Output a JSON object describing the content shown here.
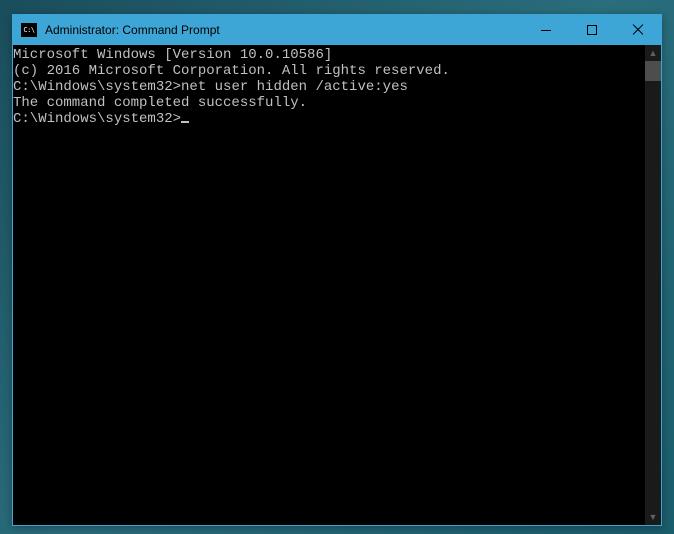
{
  "window": {
    "icon_text": "C:\\",
    "title": "Administrator: Command Prompt"
  },
  "terminal": {
    "lines": {
      "version": "Microsoft Windows [Version 10.0.10586]",
      "copyright": "(c) 2016 Microsoft Corporation. All rights reserved.",
      "blank1": "",
      "prompt1": "C:\\Windows\\system32>",
      "command1": "net user hidden /active:yes",
      "result1": "The command completed successfully.",
      "blank2": "",
      "blank3": "",
      "prompt2": "C:\\Windows\\system32>"
    }
  }
}
